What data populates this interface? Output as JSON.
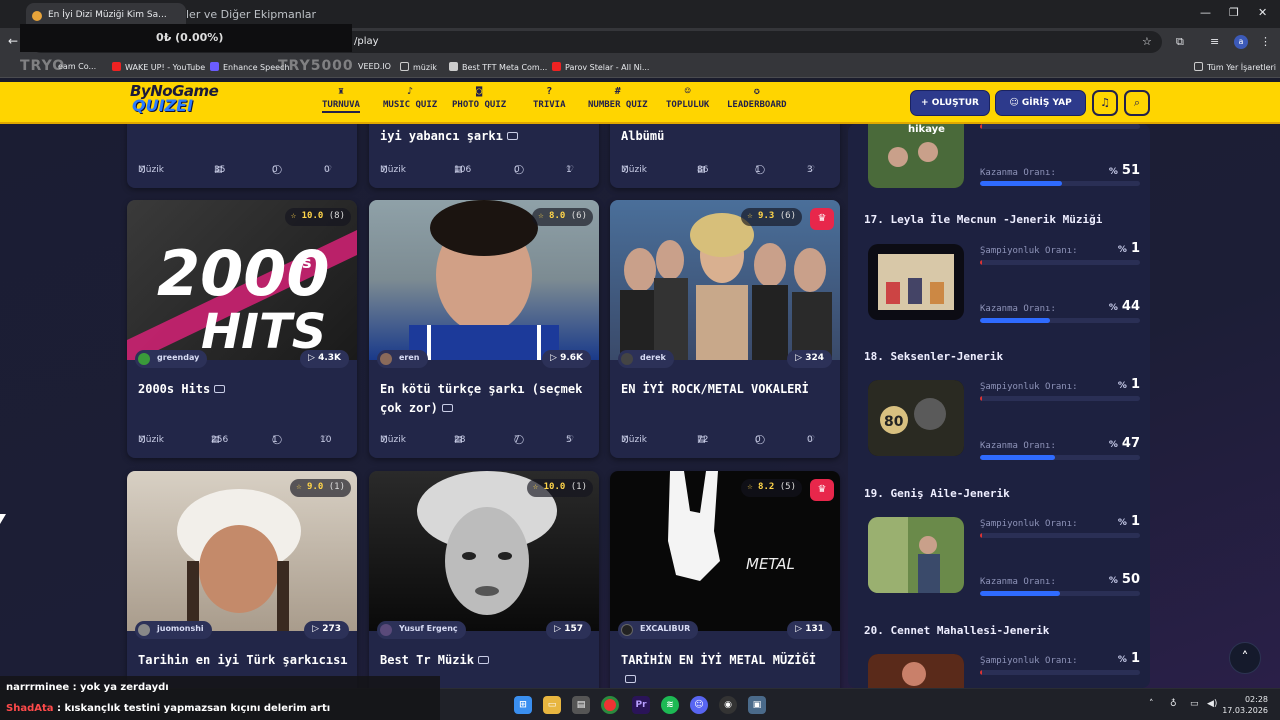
{
  "browser": {
    "tab_title": "En İyi Dizi Müziği Kim Sa...",
    "tab_ghost": "ler ve Diğer Ekipmanlar",
    "url": "/play",
    "bookmarks": [
      "WAKE UP! - YouTube",
      "Enhance Speech",
      "VEED.IO",
      "müzik",
      "Best TFT Meta Com...",
      "Parov Stelar - All Ni...",
      "Tüm Yer İşaretleri"
    ],
    "bookmark_partial": "eam Co..."
  },
  "overlay": {
    "counter": "0₺ (0.00%)",
    "watermark_left": "TRYO",
    "watermark_right": "TRY5000"
  },
  "site": {
    "logo_top": "ByNoGame",
    "logo_bottom": "QUIZEI",
    "nav": [
      {
        "label": "TURNUVA",
        "icon": "trophy-icon"
      },
      {
        "label": "MUSIC QUIZ",
        "icon": "music-note-icon"
      },
      {
        "label": "PHOTO QUIZ",
        "icon": "camera-icon"
      },
      {
        "label": "TRIVIA",
        "icon": "question-bubble-icon"
      },
      {
        "label": "NUMBER QUIZ",
        "icon": "hash-icon"
      },
      {
        "label": "TOPLULUK",
        "icon": "users-icon"
      },
      {
        "label": "LEADERBOARD",
        "icon": "medal-icon"
      }
    ],
    "create_button": "+ OLUŞTUR",
    "login_button": "GİRİŞ YAP"
  },
  "top_row": [
    {
      "title": "...",
      "category": "Müzik",
      "questions": "35",
      "comments": "0",
      "likes": "0"
    },
    {
      "title": "iyi yabancı şarkı",
      "category": "Müzik",
      "questions": "106",
      "comments": "0",
      "likes": "1"
    },
    {
      "title": "Albümü",
      "category": "Müzik",
      "questions": "86",
      "comments": "1",
      "likes": "3"
    }
  ],
  "cards": [
    {
      "title": "2000s Hits",
      "rating": "10.0",
      "rating_count": "(8)",
      "author": "greenday",
      "plays": "4.3K",
      "category": "Müzik",
      "questions": "256",
      "comments": "1",
      "likes": "10",
      "cover_text_1": "2000",
      "cover_text_2": "HITS",
      "cover_text_s": "s"
    },
    {
      "title": "En kötü türkçe şarkı (seçmek çok zor)",
      "rating": "8.0",
      "rating_count": "(6)",
      "author": "eren",
      "plays": "9.6K",
      "category": "Müzik",
      "questions": "28",
      "comments": "7",
      "likes": "5"
    },
    {
      "title": "EN İYİ ROCK/METAL VOKALERİ",
      "rating": "9.3",
      "rating_count": "(6)",
      "author": "derek",
      "plays": "324",
      "category": "Müzik",
      "questions": "72",
      "comments": "0",
      "likes": "0"
    },
    {
      "title": "Tarihin en iyi Türk şarkıcısı",
      "rating": "9.0",
      "rating_count": "(1)",
      "author": "juomonshi",
      "plays": "273"
    },
    {
      "title": "Best Tr Müzik",
      "rating": "10.0",
      "rating_count": "(1)",
      "author": "Yusuf Ergenç",
      "plays": "157"
    },
    {
      "title": "TARİHİN EN İYİ METAL MÜZİĞİ",
      "rating": "8.2",
      "rating_count": "(5)",
      "author": "EXCALIBUR",
      "plays": "131",
      "cover_text": "METAL"
    }
  ],
  "leaderboard": {
    "entries": [
      {
        "rank_title": "",
        "thumb_text": "hikaye",
        "champ_label": "",
        "win_label": "Kazanma Oranı:",
        "win_value": "51",
        "win_rate": 0.51
      },
      {
        "rank_title": "17. Leyla İle Mecnun -Jenerik Müziği",
        "champ_label": "Şampiyonluk Oranı:",
        "champ_value": "1",
        "champ_rate": 0.01,
        "win_label": "Kazanma Oranı:",
        "win_value": "44",
        "win_rate": 0.44
      },
      {
        "rank_title": "18. Seksenler-Jenerik",
        "thumb_text": "80",
        "champ_label": "Şampiyonluk Oranı:",
        "champ_value": "1",
        "champ_rate": 0.01,
        "win_label": "Kazanma Oranı:",
        "win_value": "47",
        "win_rate": 0.47
      },
      {
        "rank_title": "19. Geniş Aile-Jenerik",
        "champ_label": "Şampiyonluk Oranı:",
        "champ_value": "1",
        "champ_rate": 0.01,
        "win_label": "Kazanma Oranı:",
        "win_value": "50",
        "win_rate": 0.5
      },
      {
        "rank_title": "20. Cennet Mahallesi-Jenerik",
        "champ_label": "Şampiyonluk Oranı:",
        "champ_value": "1",
        "champ_rate": 0.01
      }
    ],
    "pct": "%"
  },
  "chat": [
    {
      "user": "narrrminee",
      "message": " : yok ya zerdaydı",
      "color": "#ffffff"
    },
    {
      "user": "ShadAta",
      "message": " : kıskançlık testini yapmazsan kıçını delerim artı",
      "color": "#ff4a4a"
    }
  ],
  "taskbar": {
    "time": "02:28",
    "date": "17.03.2026"
  }
}
